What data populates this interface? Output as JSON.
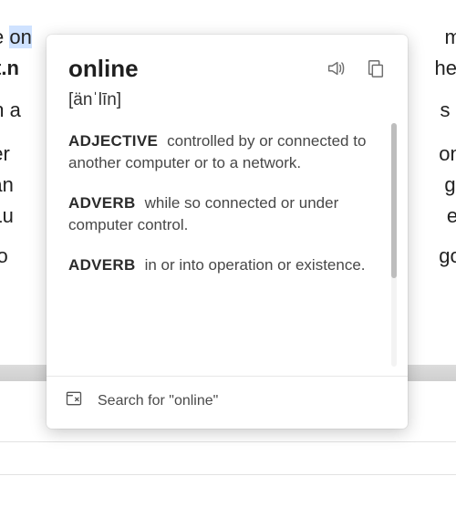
{
  "background_text": {
    "l1_prefix": "e ",
    "l1_selected": "on",
    "r1": "mo",
    "l2": "ort.n",
    "r2": "he i",
    "l3": "an a",
    "r3": "s at",
    "l4": "over",
    "r4": "one",
    "l5": "d an",
    "r5": "get",
    "l6": "o Lu",
    "r6": "ew",
    "l7": "fo o",
    "r7": "go t"
  },
  "dictionary": {
    "word": "online",
    "pronunciation": "[änˈlīn]",
    "definitions": [
      {
        "pos": "ADJECTIVE",
        "text": "controlled by or connected to another computer or to a network."
      },
      {
        "pos": "ADVERB",
        "text": "while so connected or under computer control."
      },
      {
        "pos": "ADVERB",
        "text": "in or into operation or existence."
      }
    ],
    "search_label": "Search for \"online\""
  }
}
